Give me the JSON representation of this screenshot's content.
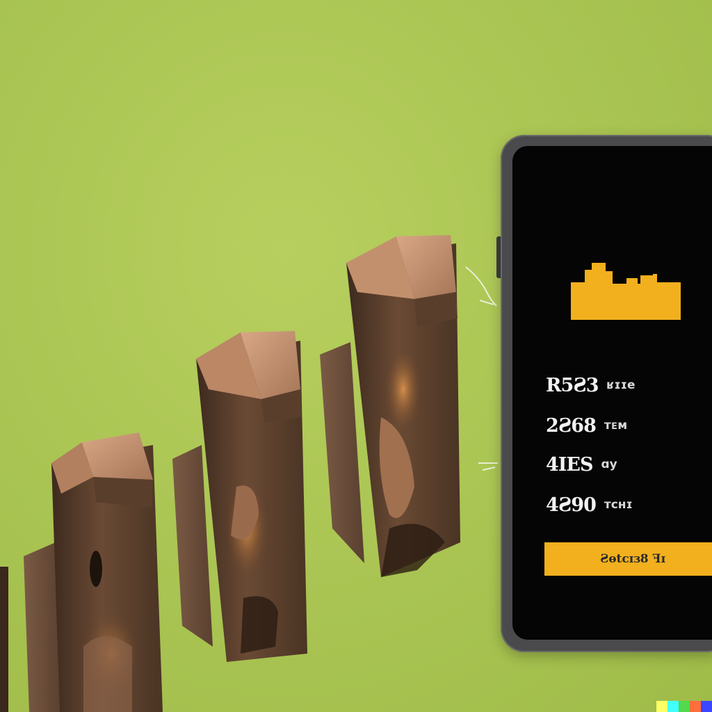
{
  "phone": {
    "stats": [
      {
        "value": "R5Ƨ3",
        "unit": "ʁɪɪe"
      },
      {
        "value": "2Ƨ68",
        "unit": "ᴛᴇᴍ"
      },
      {
        "value": "4IES",
        "unit": "ɑy"
      },
      {
        "value": "4Ƨ90",
        "unit": "ᴛᴄʜɪ"
      }
    ],
    "cta_label": "Ƨɵtᴄɪɜ8 ꟻɪ",
    "accent_color": "#f2b01e",
    "screen_bg": "#050505"
  },
  "scene": {
    "background_color": "#a9c452",
    "objects": [
      "wooden-block-1",
      "wooden-block-2",
      "wooden-block-3",
      "wooden-block-4"
    ]
  },
  "watermark": {
    "colors": [
      "#ffff66",
      "#42ffff",
      "#51da4c",
      "#ff6e3c",
      "#3c46ff"
    ]
  }
}
